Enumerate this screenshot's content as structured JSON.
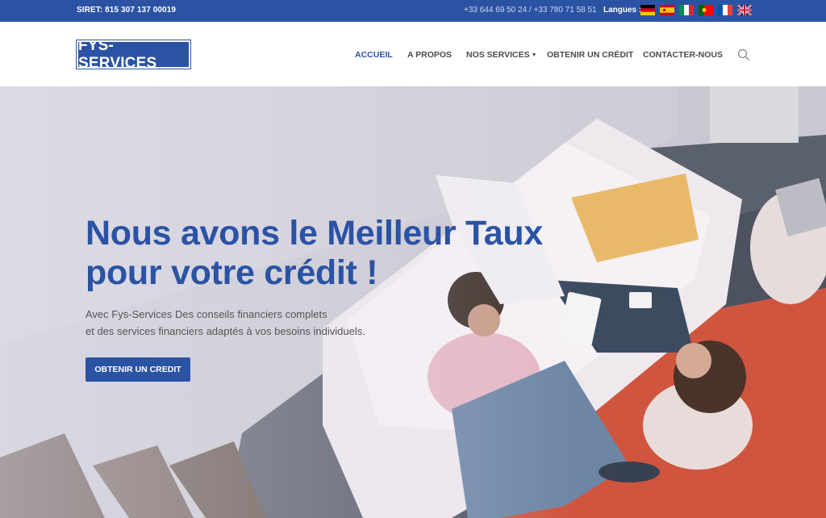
{
  "topbar": {
    "siret": "SIRET: 815 307 137 00019",
    "phones": "+33 644 69 50 24 / +33 780 71 58 51",
    "langues_label": "Langues :",
    "flags": [
      "german-flag-icon",
      "spanish-flag-icon",
      "italian-flag-icon",
      "portuguese-flag-icon",
      "french-flag-icon",
      "uk-flag-icon"
    ]
  },
  "header": {
    "logo": "FYS-SERVICES",
    "nav": {
      "accueil": "ACCUEIL",
      "apropos": "A PROPOS",
      "services": "NOS SERVICES",
      "credit": "OBTENIR UN CRÉDIT",
      "contact": "CONTACTER-NOUS"
    },
    "search_icon": "search-icon"
  },
  "hero": {
    "title_line1": "Nous avons le Meilleur Taux",
    "title_line2": "pour votre crédit !",
    "text_line1": "Avec Fys-Services Des conseils financiers complets",
    "text_line2": "et des services financiers adaptés à vos besoins individuels.",
    "cta": "OBTENIR UN CREDIT"
  },
  "colors": {
    "brand": "#2b53a4",
    "nav_text": "#4a4a4a",
    "hero_text": "#555555"
  }
}
